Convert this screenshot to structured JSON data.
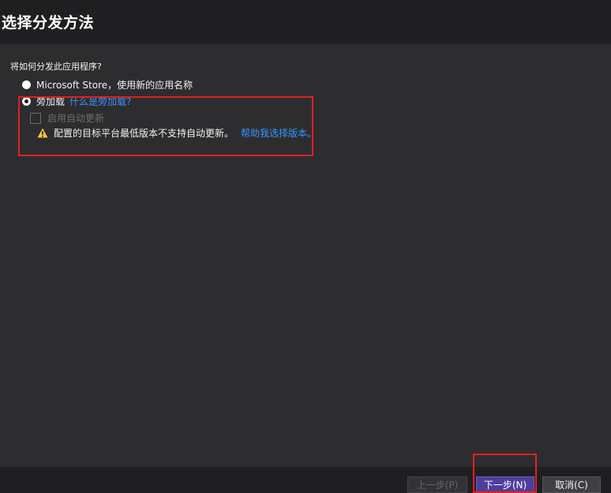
{
  "dialog": {
    "title": "选择分发方法"
  },
  "content": {
    "question": "将如何分发此应用程序?",
    "options": [
      {
        "label": "Microsoft Store，使用新的应用名称",
        "selected": false
      },
      {
        "label": "旁加载",
        "selected": true,
        "link": "什么是旁加载?"
      }
    ],
    "auto_update": {
      "label": "启用自动更新",
      "checked": false,
      "enabled": false
    },
    "warning": {
      "icon": "warning-icon",
      "text": "配置的目标平台最低版本不支持自动更新。",
      "link": "帮助我选择版本。"
    }
  },
  "footer": {
    "prev_label": "上一步(P)",
    "next_label": "下一步(N)",
    "cancel_label": "取消(C)"
  },
  "colors": {
    "accent": "#4f3d9c",
    "link": "#3794ff",
    "highlight": "#e02121"
  }
}
